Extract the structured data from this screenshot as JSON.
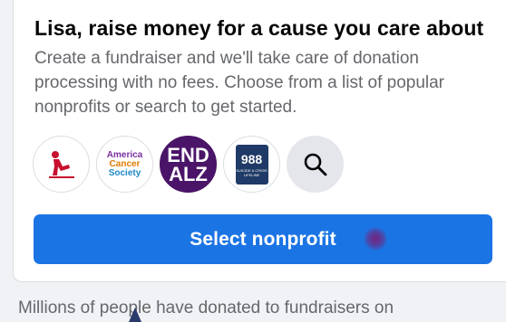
{
  "card": {
    "title": "Lisa, raise money for a cause you care about",
    "description": "Create a fundraiser and we'll take care of donation processing with no fees. Choose from a list of popular nonprofits or search to get started.",
    "nonprofits": [
      {
        "name": "St. Jude",
        "icon": "st-jude-logo"
      },
      {
        "name": "American Cancer Society",
        "icon": "american-cancer-society-logo",
        "text_lines": [
          "America",
          "Cancer",
          "Society"
        ]
      },
      {
        "name": "END ALZ",
        "icon": "end-alz-logo",
        "text_lines": [
          "END",
          "ALZ"
        ],
        "color": "#4a1468"
      },
      {
        "name": "988 Suicide & Crisis Lifeline",
        "icon": "988-lifeline-logo",
        "number": "988",
        "subtext": "SUICIDE & CRISIS LIFELINE",
        "color": "#1f3a66"
      }
    ],
    "search_icon": "search-icon",
    "select_button_label": "Select nonprofit",
    "accent_color": "#1b74e4"
  },
  "footer": {
    "text": "Millions of people have donated to fundraisers on"
  }
}
